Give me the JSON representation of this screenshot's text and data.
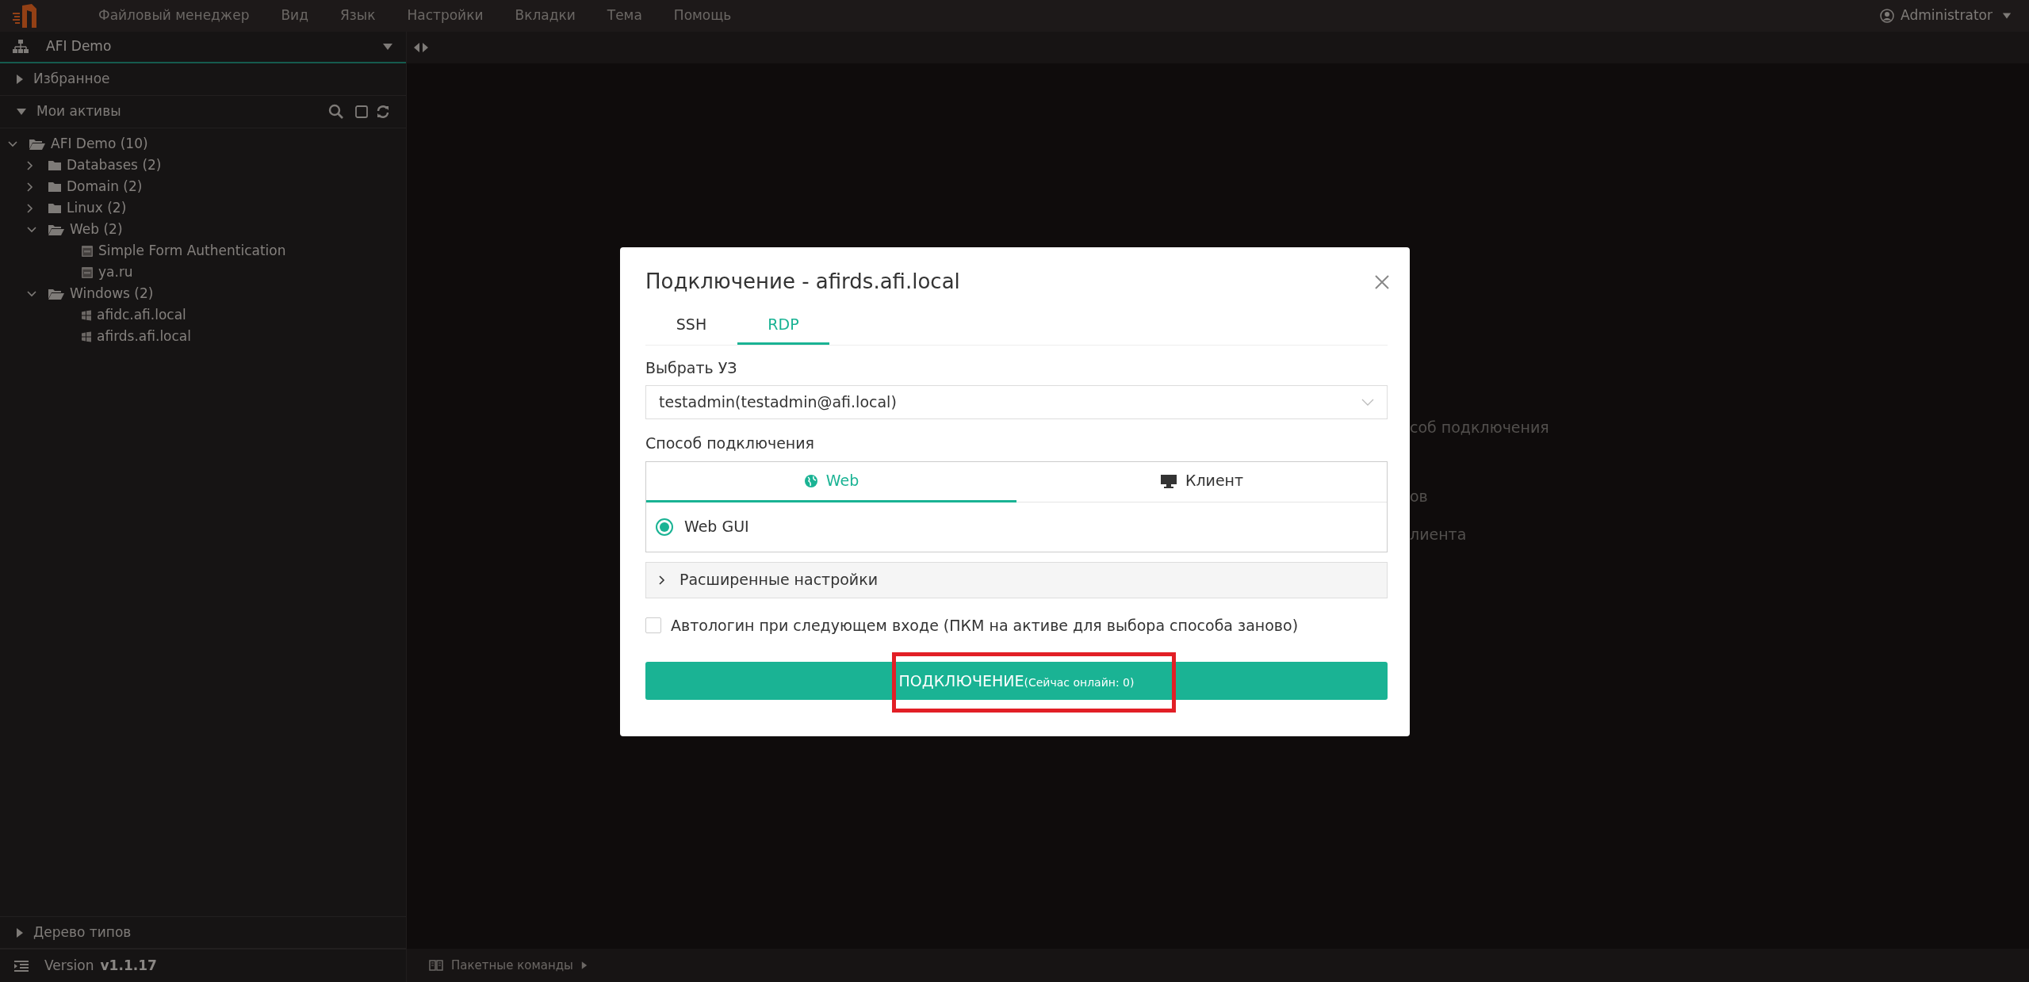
{
  "menu": {
    "items": [
      "Файловый менеджер",
      "Вид",
      "Язык",
      "Настройки",
      "Вкладки",
      "Тема",
      "Помощь"
    ],
    "user": "Administrator"
  },
  "sidebar": {
    "workspace": "AFI Demo",
    "sections": [
      {
        "title": "Избранное",
        "expanded": false
      },
      {
        "title": "Мои активы",
        "expanded": true
      }
    ],
    "tree": [
      {
        "label": "AFI Demo (10)",
        "kind": "folder",
        "expanded": true,
        "children": [
          {
            "label": "Databases (2)",
            "kind": "folder",
            "expanded": false
          },
          {
            "label": "Domain (2)",
            "kind": "folder",
            "expanded": false
          },
          {
            "label": "Linux (2)",
            "kind": "folder",
            "expanded": false
          },
          {
            "label": "Web (2)",
            "kind": "folder",
            "expanded": true,
            "children": [
              {
                "label": "Simple Form Authentication",
                "kind": "web"
              },
              {
                "label": "ya.ru",
                "kind": "web"
              }
            ]
          },
          {
            "label": "Windows (2)",
            "kind": "folder",
            "expanded": true,
            "children": [
              {
                "label": "afidc.afi.local",
                "kind": "windows"
              },
              {
                "label": "afirds.afi.local",
                "kind": "windows"
              }
            ]
          }
        ]
      }
    ],
    "type_tree": {
      "title": "Дерево типов",
      "expanded": false
    },
    "version_label": "Version",
    "version": "v1.1.17"
  },
  "main": {
    "background_lines": [
      "соб подключения",
      "ов",
      "лиента"
    ],
    "status_bar": "Пакетные команды"
  },
  "dialog": {
    "title": "Подключение - afirds.afi.local",
    "tabs": [
      {
        "label": "SSH",
        "selected": false
      },
      {
        "label": "RDP",
        "selected": true
      }
    ],
    "account_label": "Выбрать УЗ",
    "account_value": "testadmin(testadmin@afi.local)",
    "method_label": "Способ подключения",
    "methods": [
      {
        "label": "Web",
        "kind": "web",
        "selected": true
      },
      {
        "label": "Клиент",
        "kind": "client",
        "selected": false
      }
    ],
    "options": [
      {
        "label": "Web GUI",
        "selected": true
      }
    ],
    "advanced": {
      "label": "Расширенные настройки",
      "expanded": false
    },
    "autologin": {
      "label": "Автологин при следующем входе (ПКМ на активе для выбора способа заново)",
      "checked": false
    },
    "connect_button": {
      "label": "ПОДКЛЮЧЕНИЕ",
      "note": "(Сейчас онлайн: 0)",
      "highlighted": true
    }
  }
}
